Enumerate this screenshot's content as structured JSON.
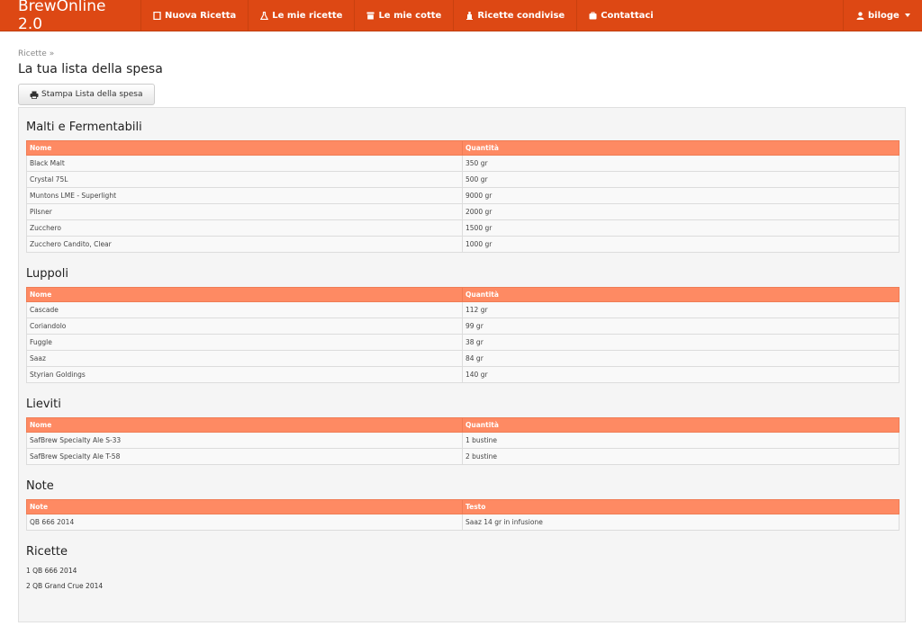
{
  "navbar": {
    "brand": "BrewOnline 2.0",
    "items": [
      {
        "label": "Nuova Ricetta",
        "icon": "document-icon"
      },
      {
        "label": "Le mie ricette",
        "icon": "flask-icon"
      },
      {
        "label": "Le mie cotte",
        "icon": "barrel-icon"
      },
      {
        "label": "Ricette condivise",
        "icon": "bottle-icon"
      },
      {
        "label": "Contattaci",
        "icon": "briefcase-icon"
      }
    ],
    "user": "biloge",
    "user_icon": "user-icon"
  },
  "breadcrumb": "Ricette »",
  "page_title": "La tua lista della spesa",
  "print_button": "Stampa Lista della spesa",
  "sections": {
    "malti": {
      "title": "Malti e Fermentabili",
      "headers": [
        "Nome",
        "Quantità"
      ],
      "rows": [
        [
          "Black Malt",
          "350 gr"
        ],
        [
          "Crystal 75L",
          "500 gr"
        ],
        [
          "Muntons LME - Superlight",
          "9000 gr"
        ],
        [
          "Pilsner",
          "2000 gr"
        ],
        [
          "Zucchero",
          "1500 gr"
        ],
        [
          "Zucchero Candito, Clear",
          "1000 gr"
        ]
      ]
    },
    "luppoli": {
      "title": "Luppoli",
      "headers": [
        "Nome",
        "Quantità"
      ],
      "rows": [
        [
          "Cascade",
          "112 gr"
        ],
        [
          "Coriandolo",
          "99 gr"
        ],
        [
          "Fuggle",
          "38 gr"
        ],
        [
          "Saaz",
          "84 gr"
        ],
        [
          "Styrian Goldings",
          "140 gr"
        ]
      ]
    },
    "lieviti": {
      "title": "Lieviti",
      "headers": [
        "Nome",
        "Quantità"
      ],
      "rows": [
        [
          "SafBrew Specialty Ale S-33",
          "1 bustine"
        ],
        [
          "SafBrew Specialty Ale T-58",
          "2 bustine"
        ]
      ]
    },
    "note": {
      "title": "Note",
      "headers": [
        "Note",
        "Testo"
      ],
      "rows": [
        [
          "QB 666 2014",
          "Saaz 14 gr in infusione"
        ]
      ]
    },
    "ricette": {
      "title": "Ricette",
      "items": [
        "1 QB 666 2014",
        "2 QB Grand Crue 2014"
      ]
    }
  }
}
